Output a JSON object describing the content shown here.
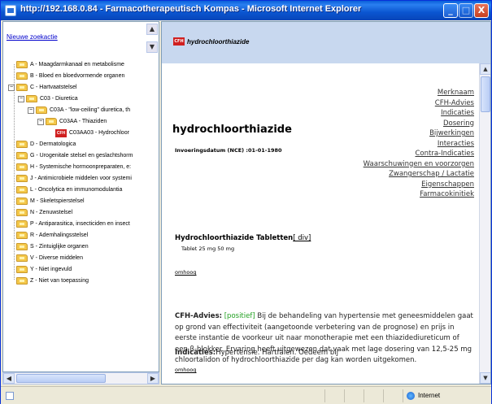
{
  "window": {
    "title": "http://192.168.0.84 - Farmacotherapeutisch Kompas - Microsoft Internet Explorer",
    "min_label": "_",
    "max_label": "□",
    "close_label": "X"
  },
  "left": {
    "new_search": "Nieuwe zoekactie",
    "tree": [
      "A - Maagdarmkanaal en metabolisme",
      "B - Bloed en bloedvormende organen",
      "C - Hartvaatstelsel",
      "C03 - Diuretica",
      "C03A - \"low-ceiling\" diuretica, th",
      "C03AA - Thiaziden",
      "C03AA03 - Hydrochloor",
      "D - Dermatologica",
      "G - Urogenitale stelsel en geslachtshorm",
      "H - Systemische hormoonpreparaten, e:",
      "J - Antimicrobiele middelen voor systemi",
      "L - Oncolytica en immunomodulantia",
      "M - Skeletspierstelsel",
      "N - Zenuwstelsel",
      "P - Antiparasitica, insecticiden en insect",
      "R - Ademhalingsstelsel",
      "S - Zintuiglijke organen",
      "V - Diverse middelen",
      "Y - Niet ingevuld",
      "Z - Niet van toepassing"
    ]
  },
  "header": {
    "logo": "CFH",
    "title": "hydrochloorthiazide"
  },
  "doc": {
    "links": [
      "Merknaam",
      "CFH-Advies",
      "Indicaties",
      "Dosering",
      "Bijwerkingen",
      "Interacties",
      "Contra-Indicaties",
      "Waarschuwingen en voorzorgen",
      "Zwangerschap / Lactatie",
      "Eigenschappen",
      "Farmacokinitiek"
    ],
    "title": "hydrochloorthiazide",
    "intro_date": "Invoeringsdatum (NCE) :01-01-1980",
    "product_title": "Hydrochloorthiazide Tabletten",
    "div_link": "[ div]",
    "tablet": "Tablet 25 mg 50 mg",
    "omhoog": "omhoog",
    "advies_label": "CFH-Advies:",
    "advies_tag": "[positief]",
    "advies_text": " Bij de behandeling van hypertensie met geneesmiddelen gaat op grond van effectiviteit (aangetoonde verbetering van de prognose) en prijs in eerste instantie de voorkeur uit naar monotherapie met een thiazidediureticum of een β-blokker. Ervaring heeft uitgewezen dat vaak met lage dosering van 12,5-25 mg chloortalidon of hydrochloorthiazide per dag kan worden uitgekomen.",
    "indicaties_label": "Indicaties:",
    "indicaties_text": "Hypertensie. Hartfalen. Oedeem bij"
  },
  "status": {
    "zone": "Internet"
  }
}
